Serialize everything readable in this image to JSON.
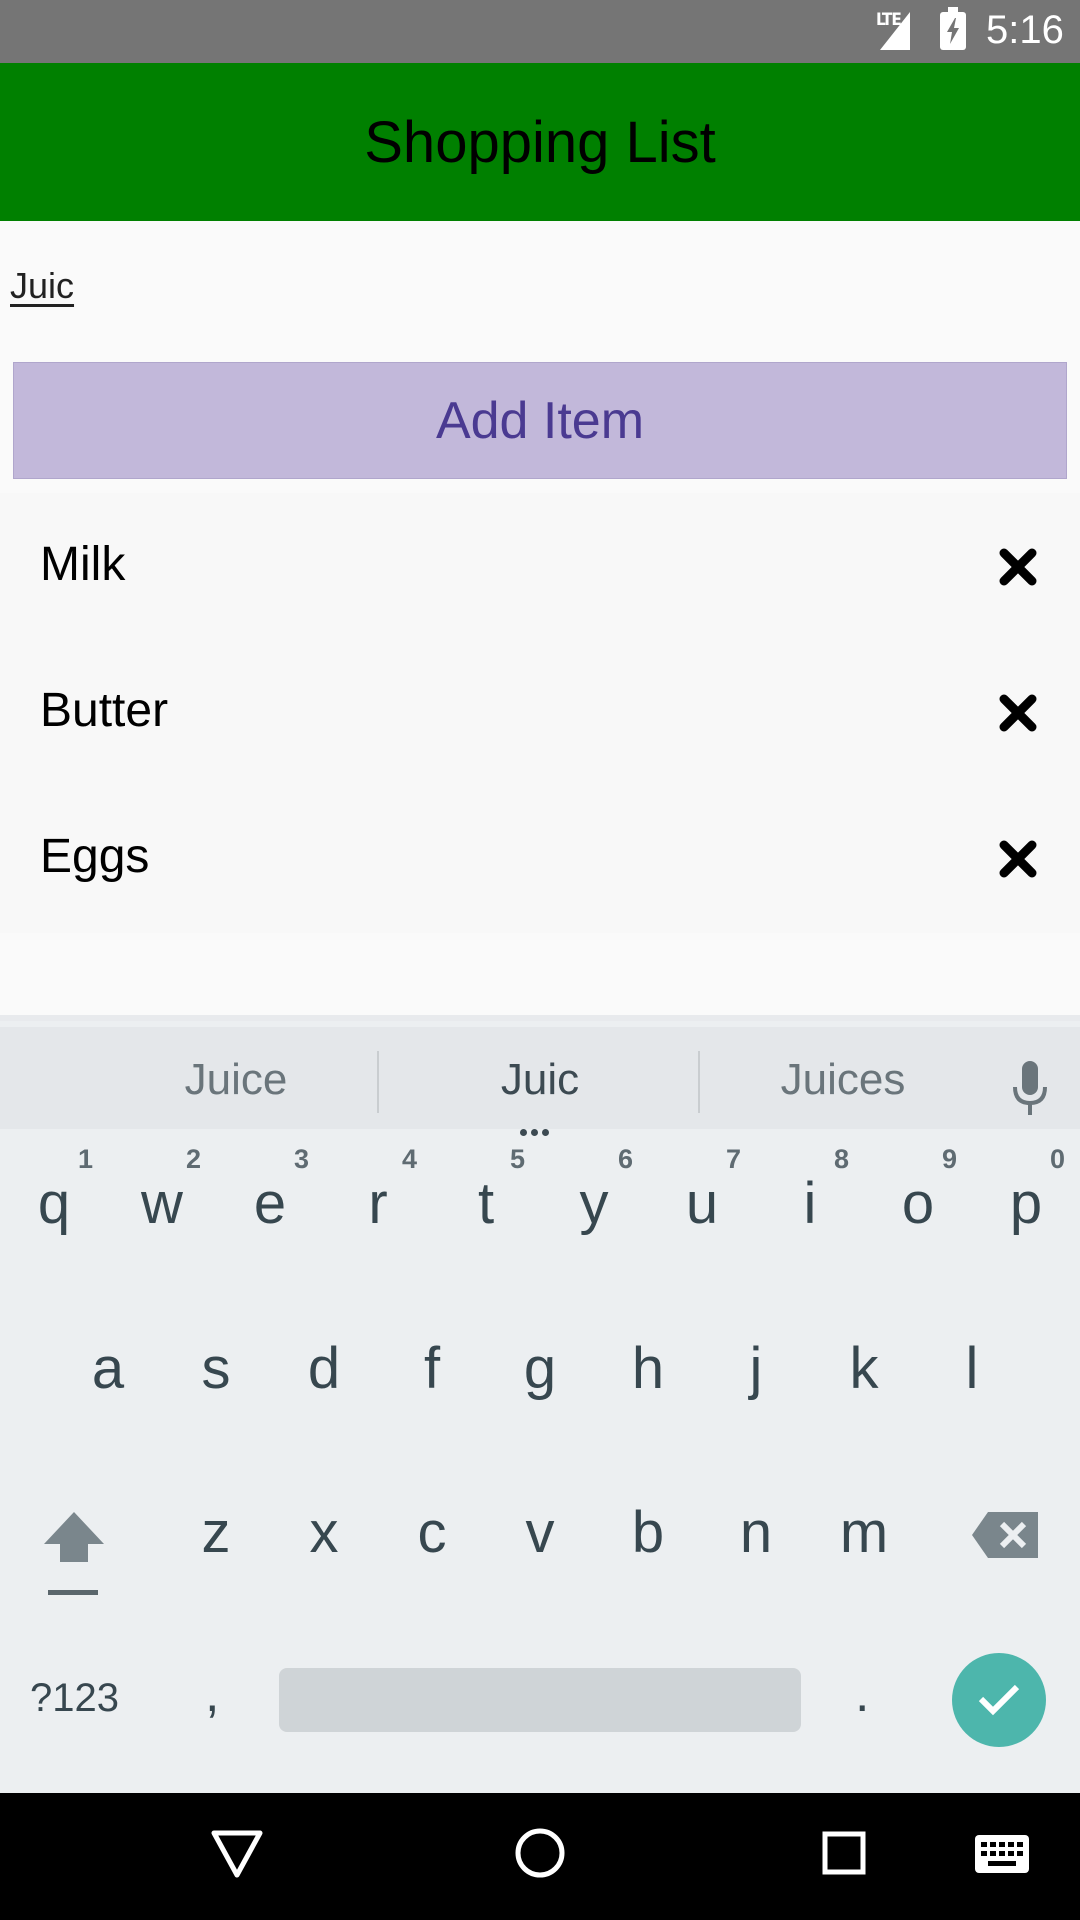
{
  "status_bar": {
    "network": "LTE",
    "time": "5:16"
  },
  "app_bar": {
    "title": "Shopping List"
  },
  "item_input": {
    "value": "Juic"
  },
  "add_button": {
    "label": "Add Item"
  },
  "shopping_list": {
    "items": [
      {
        "label": "Milk"
      },
      {
        "label": "Butter"
      },
      {
        "label": "Eggs"
      }
    ]
  },
  "keyboard": {
    "suggestions": [
      "Juice",
      "Juic",
      "Juices"
    ],
    "row1": [
      "q",
      "w",
      "e",
      "r",
      "t",
      "y",
      "u",
      "i",
      "o",
      "p"
    ],
    "row1_hints": [
      "1",
      "2",
      "3",
      "4",
      "5",
      "6",
      "7",
      "8",
      "9",
      "0"
    ],
    "row2": [
      "a",
      "s",
      "d",
      "f",
      "g",
      "h",
      "j",
      "k",
      "l"
    ],
    "row3": [
      "z",
      "x",
      "c",
      "v",
      "b",
      "n",
      "m"
    ],
    "symbols_label": "?123",
    "comma_label": ",",
    "period_label": ".",
    "icons": {
      "shift": "shift-icon",
      "backspace": "backspace-icon",
      "enter": "checkmark-icon",
      "mic": "mic-icon"
    },
    "colors": {
      "enter_bg": "#4db6ac"
    }
  },
  "colors": {
    "app_bar": "#008000",
    "add_button_bg": "#c2b8da",
    "add_button_text": "#4a3a91"
  }
}
